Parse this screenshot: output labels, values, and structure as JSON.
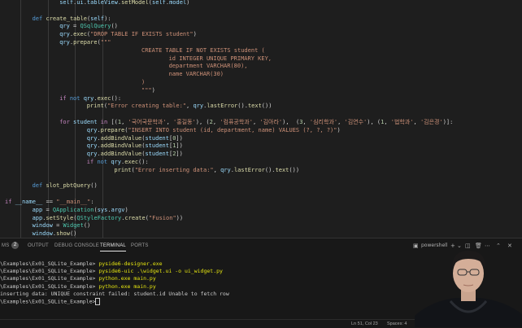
{
  "editor": {
    "lines": [
      [
        [
          "var",
          "self"
        ],
        [
          "op",
          "."
        ],
        [
          "var",
          "ui"
        ],
        [
          "op",
          "."
        ],
        [
          "var",
          "tableView"
        ],
        [
          "op",
          "."
        ],
        [
          "fn",
          "setModel"
        ],
        [
          "op",
          "("
        ],
        [
          "var",
          "self"
        ],
        [
          "op",
          "."
        ],
        [
          "var",
          "model"
        ],
        [
          "op",
          ")"
        ]
      ],
      [],
      [
        [
          "kw",
          "def "
        ],
        [
          "fn",
          "create_table"
        ],
        [
          "op",
          "("
        ],
        [
          "var",
          "self"
        ],
        [
          "op",
          "):"
        ]
      ],
      [
        [
          "var",
          "qry"
        ],
        [
          "op",
          " = "
        ],
        [
          "cls",
          "QSqlQuery"
        ],
        [
          "op",
          "()"
        ]
      ],
      [
        [
          "var",
          "qry"
        ],
        [
          "op",
          "."
        ],
        [
          "fn",
          "exec"
        ],
        [
          "op",
          "("
        ],
        [
          "str",
          "\"DROP TABLE IF EXISTS student\""
        ],
        [
          "op",
          ")"
        ]
      ],
      [
        [
          "var",
          "qry"
        ],
        [
          "op",
          "."
        ],
        [
          "fn",
          "prepare"
        ],
        [
          "op",
          "("
        ],
        [
          "str",
          "\"\"\""
        ]
      ],
      [
        [
          "str",
          "CREATE TABLE IF NOT EXISTS student ("
        ]
      ],
      [
        [
          "str",
          "id INTEGER UNIQUE PRIMARY KEY,"
        ]
      ],
      [
        [
          "str",
          "department VARCHAR(80),"
        ]
      ],
      [
        [
          "str",
          "name VARCHAR(30)"
        ]
      ],
      [
        [
          "str",
          ")"
        ]
      ],
      [
        [
          "str",
          "\"\"\""
        ],
        [
          "op",
          ")"
        ]
      ],
      [
        [
          "ctl",
          "if "
        ],
        [
          "kw",
          "not "
        ],
        [
          "var",
          "qry"
        ],
        [
          "op",
          "."
        ],
        [
          "fn",
          "exec"
        ],
        [
          "op",
          "():"
        ]
      ],
      [
        [
          "fn",
          "print"
        ],
        [
          "op",
          "("
        ],
        [
          "str",
          "\"Error creating table:\""
        ],
        [
          "op",
          ", "
        ],
        [
          "var",
          "qry"
        ],
        [
          "op",
          "."
        ],
        [
          "fn",
          "lastError"
        ],
        [
          "op",
          "()."
        ],
        [
          "fn",
          "text"
        ],
        [
          "op",
          "())"
        ]
      ],
      [],
      [
        [
          "ctl",
          "for "
        ],
        [
          "var",
          "student "
        ],
        [
          "ctl",
          "in "
        ],
        [
          "op",
          "[("
        ],
        [
          "num",
          "1"
        ],
        [
          "op",
          ", "
        ],
        [
          "str",
          "'국어국문학과'"
        ],
        [
          "op",
          ", "
        ],
        [
          "str",
          "'홍길동'"
        ],
        [
          "op",
          "), ("
        ],
        [
          "num",
          "2"
        ],
        [
          "op",
          ", "
        ],
        [
          "str",
          "'컴퓨공학과'"
        ],
        [
          "op",
          ", "
        ],
        [
          "str",
          "'김아라'"
        ],
        [
          "op",
          "),  ("
        ],
        [
          "num",
          "3"
        ],
        [
          "op",
          ", "
        ],
        [
          "str",
          "'심리학과'"
        ],
        [
          "op",
          ", "
        ],
        [
          "str",
          "'김연수'"
        ],
        [
          "op",
          "), ("
        ],
        [
          "num",
          "1"
        ],
        [
          "op",
          ", "
        ],
        [
          "str",
          "'법학과'"
        ],
        [
          "op",
          ", "
        ],
        [
          "str",
          "'김은경'"
        ],
        [
          "op",
          ")]:"
        ]
      ],
      [
        [
          "var",
          "qry"
        ],
        [
          "op",
          "."
        ],
        [
          "fn",
          "prepare"
        ],
        [
          "op",
          "("
        ],
        [
          "str",
          "\"INSERT INTO student (id, department, name) VALUES (?, ?, ?)\""
        ],
        [
          "op",
          ")"
        ]
      ],
      [
        [
          "var",
          "qry"
        ],
        [
          "op",
          "."
        ],
        [
          "fn",
          "addBindValue"
        ],
        [
          "op",
          "("
        ],
        [
          "var",
          "student"
        ],
        [
          "op",
          "["
        ],
        [
          "num",
          "0"
        ],
        [
          "op",
          "])"
        ]
      ],
      [
        [
          "var",
          "qry"
        ],
        [
          "op",
          "."
        ],
        [
          "fn",
          "addBindValue"
        ],
        [
          "op",
          "("
        ],
        [
          "var",
          "student"
        ],
        [
          "op",
          "["
        ],
        [
          "num",
          "1"
        ],
        [
          "op",
          "])"
        ]
      ],
      [
        [
          "var",
          "qry"
        ],
        [
          "op",
          "."
        ],
        [
          "fn",
          "addBindValue"
        ],
        [
          "op",
          "("
        ],
        [
          "var",
          "student"
        ],
        [
          "op",
          "["
        ],
        [
          "num",
          "2"
        ],
        [
          "op",
          "])"
        ]
      ],
      [
        [
          "ctl",
          "if "
        ],
        [
          "kw",
          "not "
        ],
        [
          "var",
          "qry"
        ],
        [
          "op",
          "."
        ],
        [
          "fn",
          "exec"
        ],
        [
          "op",
          "():"
        ]
      ],
      [
        [
          "fn",
          "print"
        ],
        [
          "op",
          "("
        ],
        [
          "str",
          "\"Error inserting data:\""
        ],
        [
          "op",
          ", "
        ],
        [
          "var",
          "qry"
        ],
        [
          "op",
          "."
        ],
        [
          "fn",
          "lastError"
        ],
        [
          "op",
          "()."
        ],
        [
          "fn",
          "text"
        ],
        [
          "op",
          "())"
        ]
      ],
      [],
      [
        [
          "kw",
          "def "
        ],
        [
          "fn",
          "slot_pbtQuery"
        ],
        [
          "op",
          "()"
        ]
      ],
      [],
      [
        [
          "ctl",
          "if "
        ],
        [
          "var",
          "__name__ "
        ],
        [
          "op",
          "== "
        ],
        [
          "str",
          "\"__main__\""
        ],
        [
          "op",
          ":"
        ]
      ],
      [
        [
          "var",
          "app"
        ],
        [
          "op",
          " = "
        ],
        [
          "cls",
          "QApplication"
        ],
        [
          "op",
          "("
        ],
        [
          "var",
          "sys"
        ],
        [
          "op",
          "."
        ],
        [
          "var",
          "argv"
        ],
        [
          "op",
          ")"
        ]
      ],
      [
        [
          "var",
          "app"
        ],
        [
          "op",
          "."
        ],
        [
          "fn",
          "setStyle"
        ],
        [
          "op",
          "("
        ],
        [
          "cls",
          "QStyleFactory"
        ],
        [
          "op",
          "."
        ],
        [
          "fn",
          "create"
        ],
        [
          "op",
          "("
        ],
        [
          "str",
          "\"Fusion\""
        ],
        [
          "op",
          "))"
        ]
      ],
      [
        [
          "var",
          "window"
        ],
        [
          "op",
          " = "
        ],
        [
          "cls",
          "Widget"
        ],
        [
          "op",
          "()"
        ]
      ],
      [
        [
          "var",
          "window"
        ],
        [
          "op",
          "."
        ],
        [
          "fn",
          "show"
        ],
        [
          "op",
          "()"
        ]
      ]
    ]
  },
  "panel": {
    "problems_label": "MS",
    "problems_count": "2",
    "tabs": [
      "OUTPUT",
      "DEBUG CONSOLE",
      "TERMINAL",
      "PORTS"
    ],
    "active_tab": "TERMINAL",
    "shell_label": "powershell",
    "add_glyph": "+",
    "terminal_lines": [
      {
        "prompt": "\\Examples\\Ex01_SQLite_Example>",
        "cmd": " pyside6-designer.exe"
      },
      {
        "prompt": "\\Examples\\Ex01_SQLite_Example>",
        "cmd": " pyside6-uic .\\widget.ui -o ui_widget.py"
      },
      {
        "prompt": "\\Examples\\Ex01_SQLite_Example>",
        "cmd": " python.exe main.py"
      },
      {
        "prompt": "\\Examples\\Ex01_SQLite_Example>",
        "cmd": " python.exe main.py"
      },
      {
        "prompt": "inserting data: UNIQUE constraint failed: student.id Unable to fetch row",
        "cmd": ""
      },
      {
        "prompt": "\\Examples\\Ex01_SQLite_Example>",
        "cmd": ""
      }
    ]
  },
  "statusbar": {
    "position": "Ln 51, Col 23",
    "spaces": "Spaces: 4"
  },
  "colors": {
    "editor_bg": "#1e1e1e",
    "panel_bg": "#181818",
    "keyword": "#569cd6",
    "control": "#c586c0",
    "function": "#dcdcaa",
    "string": "#ce9178",
    "variable": "#9cdcfe",
    "class": "#4ec9b0",
    "command": "#e5e510"
  }
}
